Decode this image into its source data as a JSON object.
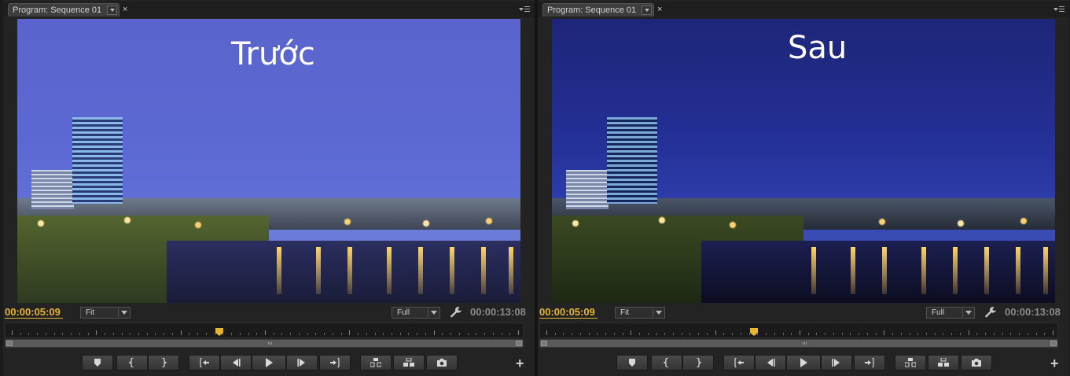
{
  "panels": [
    {
      "tab_title": "Program: Sequence 01",
      "overlay_label": "Trước",
      "timecode_current": "00:00:05:09",
      "zoom": "Fit",
      "resolution": "Full",
      "timecode_duration": "00:00:13:08",
      "playhead_fraction": 0.41
    },
    {
      "tab_title": "Program: Sequence 01",
      "overlay_label": "Sau",
      "timecode_current": "00:00:05:09",
      "zoom": "Fit",
      "resolution": "Full",
      "timecode_duration": "00:00:13:08",
      "playhead_fraction": 0.41
    }
  ],
  "icons": {
    "tab_close": "×",
    "add": "+"
  },
  "transport_buttons": [
    "add-marker",
    "mark-in",
    "mark-out",
    "go-to-in",
    "step-back",
    "play",
    "step-forward",
    "go-to-out",
    "lift",
    "extract",
    "export-frame"
  ],
  "colors": {
    "accent": "#e8b530",
    "panel_bg": "#232323"
  }
}
